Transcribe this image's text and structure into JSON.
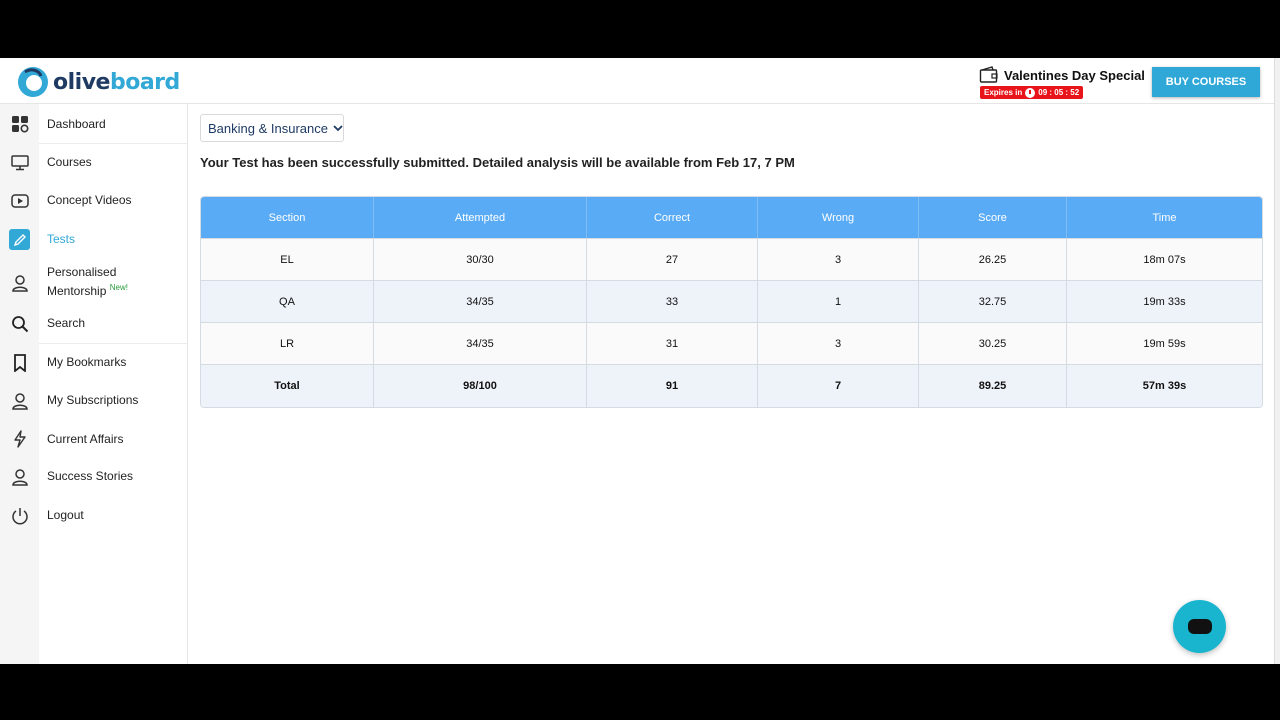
{
  "header": {
    "logo_part1": "olive",
    "logo_part2": "board",
    "promo_title": "Valentines Day Special",
    "promo_expires_label": "Expires in",
    "promo_timer": "09 : 05 : 52",
    "buy_button": "BUY COURSES"
  },
  "sidebar": {
    "items": [
      {
        "label": "Dashboard",
        "icon": "dashboard-grid-icon"
      },
      {
        "label": "Courses",
        "icon": "monitor-icon"
      },
      {
        "label": "Concept Videos",
        "icon": "play-video-icon"
      },
      {
        "label": "Tests",
        "icon": "pencil-icon",
        "active": true
      },
      {
        "label_line1": "Personalised",
        "label_line2": "Mentorship",
        "badge": "New!",
        "icon": "user-icon"
      },
      {
        "label": "Search",
        "icon": "search-icon"
      },
      {
        "label": "My Bookmarks",
        "icon": "bookmark-icon"
      },
      {
        "label": "My Subscriptions",
        "icon": "user-icon"
      },
      {
        "label": "Current Affairs",
        "icon": "lightning-icon"
      },
      {
        "label": "Success Stories",
        "icon": "user-icon"
      },
      {
        "label": "Logout",
        "icon": "power-icon"
      }
    ]
  },
  "main": {
    "category_dropdown": "Banking & Insurance",
    "notice": "Your Test has been successfully submitted. Detailed analysis will be available from Feb 17, 7 PM",
    "table": {
      "headers": [
        "Section",
        "Attempted",
        "Correct",
        "Wrong",
        "Score",
        "Time"
      ],
      "rows": [
        [
          "EL",
          "30/30",
          "27",
          "3",
          "26.25",
          "18m 07s"
        ],
        [
          "QA",
          "34/35",
          "33",
          "1",
          "32.75",
          "19m 33s"
        ],
        [
          "LR",
          "34/35",
          "31",
          "3",
          "30.25",
          "19m 59s"
        ]
      ],
      "total": [
        "Total",
        "98/100",
        "91",
        "7",
        "89.25",
        "57m 39s"
      ]
    }
  },
  "colors": {
    "brand_dark": "#1f3b64",
    "brand_accent": "#31a8d6",
    "table_header": "#5aabf5",
    "timer_red": "#e8141a",
    "chat_button": "#19b5cf"
  }
}
